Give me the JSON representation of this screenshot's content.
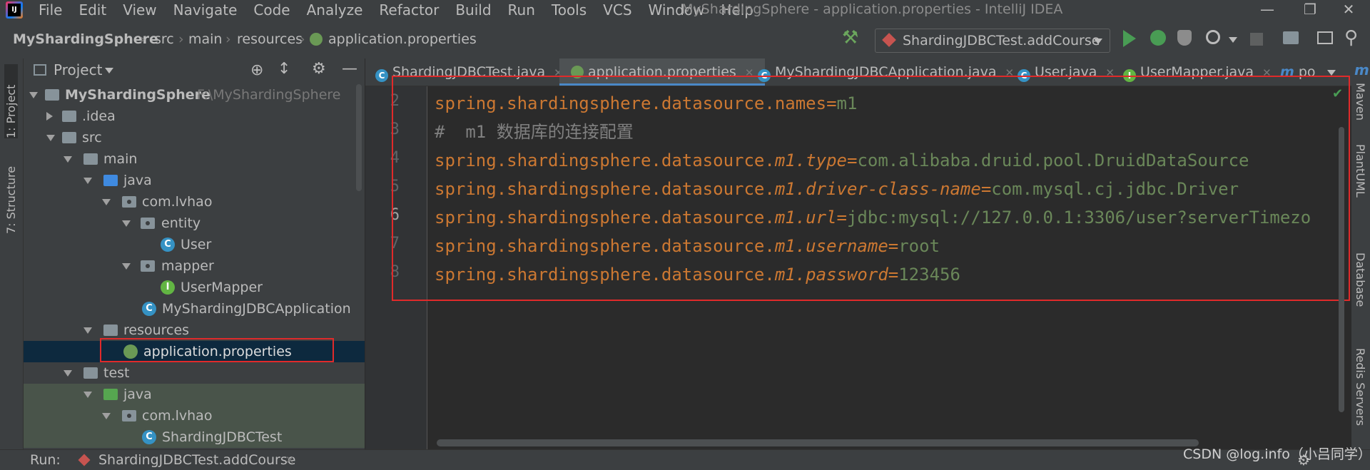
{
  "menubar": {
    "items": [
      "File",
      "Edit",
      "View",
      "Navigate",
      "Code",
      "Analyze",
      "Refactor",
      "Build",
      "Run",
      "Tools",
      "VCS",
      "Window",
      "Help"
    ],
    "title": "MyShardingSphere - application.properties - IntelliJ IDEA"
  },
  "breadcrumb": [
    "MyShardingSphere",
    "src",
    "main",
    "resources",
    "application.properties"
  ],
  "run_config": "ShardingJDBCTest.addCourse",
  "project_panel": {
    "title": "Project",
    "tree": [
      {
        "label": "MyShardingSphere",
        "hint": "F:\\MyShardingSphere"
      },
      {
        "label": ".idea"
      },
      {
        "label": "src"
      },
      {
        "label": "main"
      },
      {
        "label": "java"
      },
      {
        "label": "com.lvhao"
      },
      {
        "label": "entity"
      },
      {
        "label": "User"
      },
      {
        "label": "mapper"
      },
      {
        "label": "UserMapper"
      },
      {
        "label": "MyShardingJDBCApplication"
      },
      {
        "label": "resources"
      },
      {
        "label": "application.properties"
      },
      {
        "label": "test"
      },
      {
        "label": "java"
      },
      {
        "label": "com.lvhao"
      },
      {
        "label": "ShardingJDBCTest"
      }
    ]
  },
  "left_stripe": {
    "project": "1: Project",
    "structure": "7: Structure"
  },
  "tabs": [
    {
      "label": "ShardingJDBCTest.java",
      "active": false
    },
    {
      "label": "application.properties",
      "active": true
    },
    {
      "label": "MyShardingJDBCApplication.java",
      "active": false
    },
    {
      "label": "User.java",
      "active": false
    },
    {
      "label": "UserMapper.java",
      "active": false
    },
    {
      "label": "po",
      "active": false
    }
  ],
  "editor": {
    "line_numbers": [
      "2",
      "3",
      "4",
      "5",
      "6",
      "7",
      "8"
    ],
    "lines": [
      {
        "prefix": "spring.shardingsphere.datasource.",
        "key": "names",
        "value": "m1"
      },
      {
        "comment": "#  m1 数据库的连接配置"
      },
      {
        "prefix": "spring.shardingsphere.datasource.",
        "key": "m1.type",
        "value": "com.alibaba.druid.pool.DruidDataSource"
      },
      {
        "prefix": "spring.shardingsphere.datasource.",
        "key": "m1.driver-class-name",
        "value": "com.mysql.cj.jdbc.Driver"
      },
      {
        "prefix": "spring.shardingsphere.datasource.",
        "key": "m1.url",
        "value": "jdbc:mysql://127.0.0.1:3306/user?serverTimezo"
      },
      {
        "prefix": "spring.shardingsphere.datasource.",
        "key": "m1.username",
        "value": "root"
      },
      {
        "prefix": "spring.shardingsphere.datasource.",
        "key": "m1.password",
        "value": "123456"
      }
    ]
  },
  "right_stripe": [
    "Maven",
    "PlantUML",
    "Database",
    "Redis Servers"
  ],
  "bottom": {
    "run_label": "Run:",
    "run_tab": "ShardingJDBCTest.addCourse"
  },
  "watermark": "CSDN @log.info（小吕同学）",
  "colors": {
    "key": "#cc7832",
    "value": "#6a8759",
    "comment": "#808080",
    "highlight": "#e02a2a"
  }
}
